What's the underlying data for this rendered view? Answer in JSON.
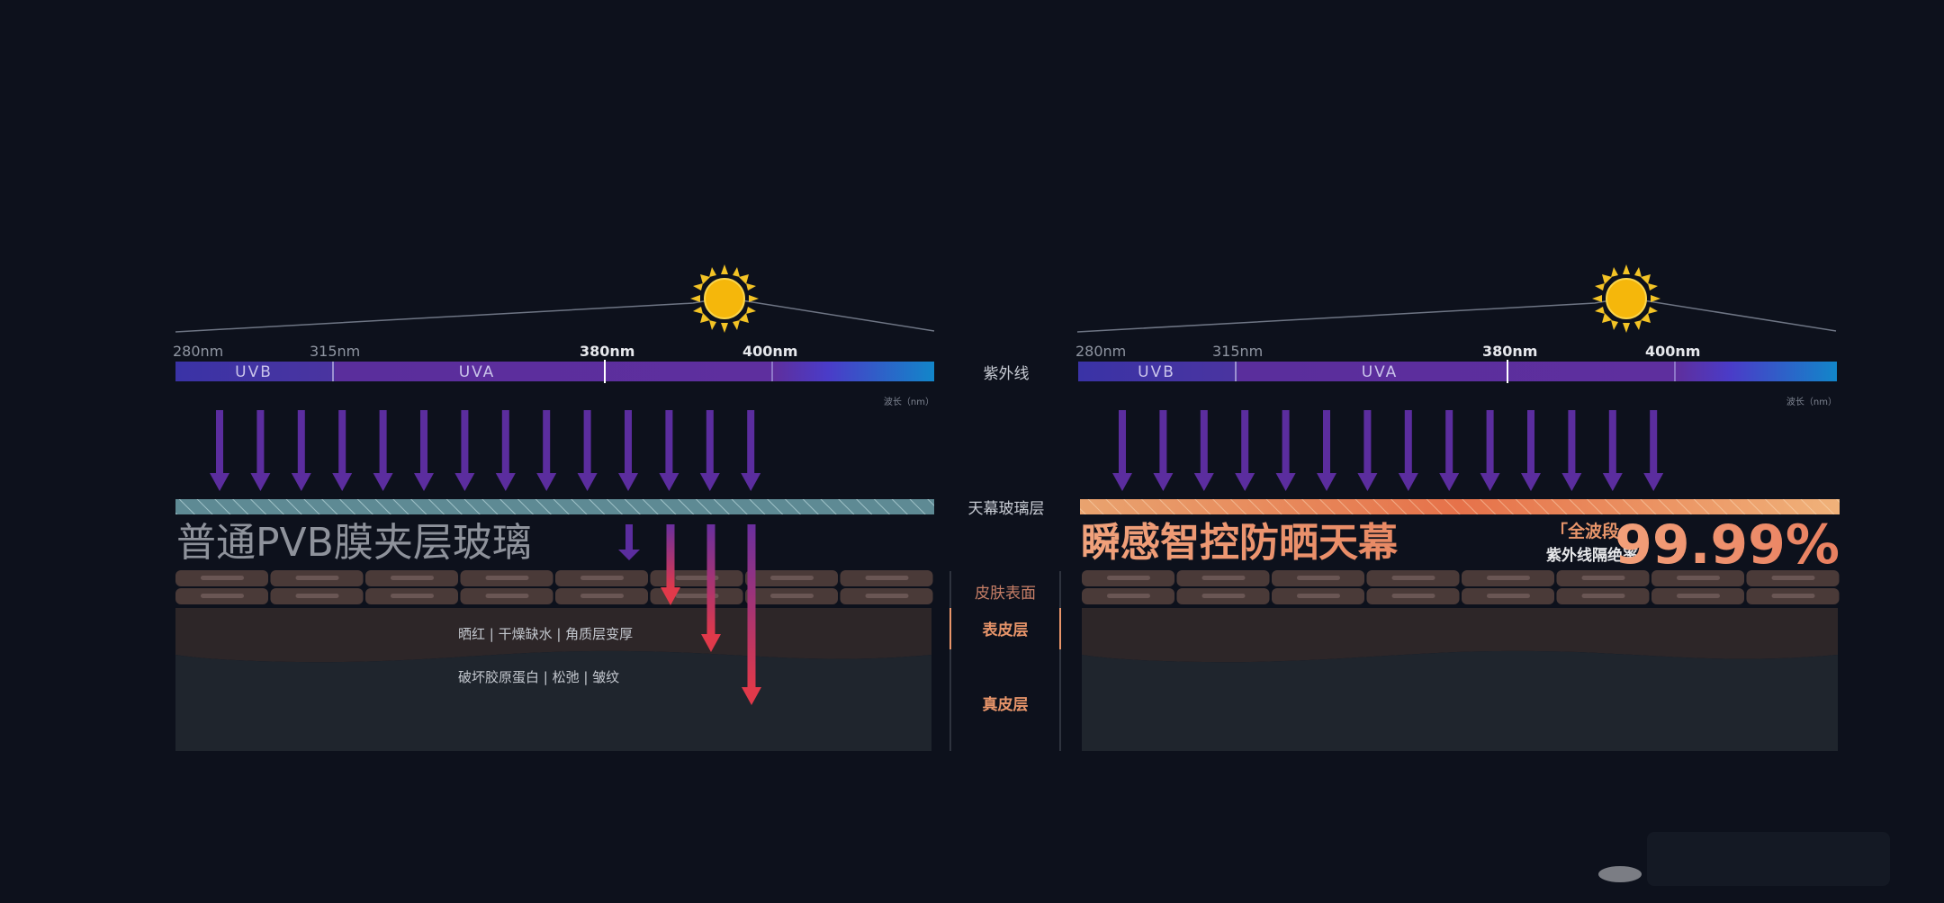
{
  "uv_label": "紫外线",
  "glass_layer_label": "天幕玻璃层",
  "skin_surface_label": "皮肤表面",
  "epidermis_label": "表皮层",
  "dermis_label": "真皮层",
  "left_panel": {
    "wavelength_labels": [
      "280nm",
      "315nm",
      "380nm",
      "400nm"
    ],
    "band_uvb": "UVB",
    "band_uva": "UVA",
    "unit_label": "波长（nm）",
    "title": "普通PVB膜夹层玻璃",
    "epidermis_effects": "晒红 | 干燥缺水 | 角质层变厚",
    "dermis_effects": "破坏胶原蛋白 | 松弛 | 皱纹"
  },
  "right_panel": {
    "wavelength_labels": [
      "280nm",
      "315nm",
      "380nm",
      "400nm"
    ],
    "band_uvb": "UVB",
    "band_uva": "UVA",
    "unit_label": "波长（nm）",
    "title": "瞬感智控防晒天幕",
    "badge_line1": "「全波段」",
    "badge_line2": "紫外线隔绝率",
    "block_rate": "99.99%"
  },
  "colors": {
    "background": "#0d111c",
    "arrow_purple": "#5b2d9e",
    "penetrating_red": "#e0394a",
    "accent_orange": "#e8956a",
    "glass_teal": "#5e8a94"
  },
  "icons": {
    "sun": "sun-icon",
    "arrow": "down-arrow-icon"
  }
}
